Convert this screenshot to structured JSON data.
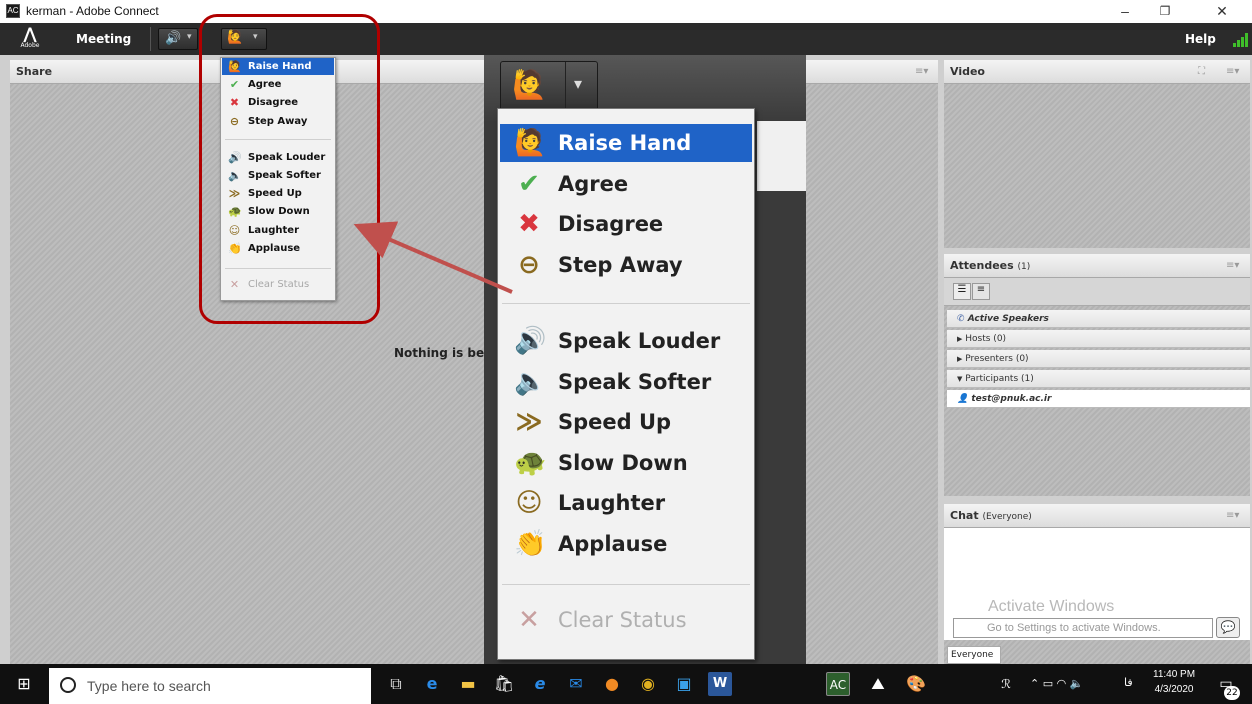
{
  "window": {
    "title": "kerman - Adobe Connect",
    "app_icon": "adobe-connect-icon",
    "minimize": "–",
    "maximize": "❐",
    "close": "✕"
  },
  "menubar": {
    "logo": "Adobe",
    "meeting": "Meeting",
    "help": "Help"
  },
  "share_pod": {
    "title": "Share",
    "placeholder": "Nothing is be"
  },
  "video_pod": {
    "title": "Video"
  },
  "status_menu": {
    "items": [
      {
        "label": "Raise Hand",
        "icon": "raise-hand-icon",
        "glyph": "🙋",
        "selected": true
      },
      {
        "label": "Agree",
        "icon": "agree-icon",
        "glyph": "✔"
      },
      {
        "label": "Disagree",
        "icon": "disagree-icon",
        "glyph": "✖"
      },
      {
        "label": "Step Away",
        "icon": "step-away-icon",
        "glyph": "⊖"
      },
      {
        "label": "Speak Louder",
        "icon": "speak-louder-icon",
        "glyph": "🔊"
      },
      {
        "label": "Speak Softer",
        "icon": "speak-softer-icon",
        "glyph": "🔈"
      },
      {
        "label": "Speed Up",
        "icon": "speed-up-icon",
        "glyph": "≫"
      },
      {
        "label": "Slow Down",
        "icon": "slow-down-icon",
        "glyph": "🐢"
      },
      {
        "label": "Laughter",
        "icon": "laughter-icon",
        "glyph": "☺"
      },
      {
        "label": "Applause",
        "icon": "applause-icon",
        "glyph": "👏"
      },
      {
        "label": "Clear Status",
        "icon": "clear-status-icon",
        "glyph": "✕",
        "disabled": true
      }
    ]
  },
  "attendees_pod": {
    "title": "Attendees",
    "count": "(1)",
    "active_speakers": "Active Speakers",
    "hosts": "Hosts (0)",
    "presenters": "Presenters (0)",
    "participants": "Participants (1)",
    "participant": "test@pnuk.ac.ir"
  },
  "chat_pod": {
    "title": "Chat",
    "scope": "(Everyone)",
    "tab": "Everyone",
    "watermark_title": "Activate Windows",
    "watermark_text": "Go to Settings to activate Windows."
  },
  "taskbar": {
    "search_placeholder": "Type here to search",
    "time": "11:40 PM",
    "date": "4/3/2020",
    "lang": "فا",
    "notifications": "22"
  },
  "colors": {
    "accent": "#1f63c7",
    "annotation": "#b00000",
    "menubar": "#2b2b2b"
  }
}
